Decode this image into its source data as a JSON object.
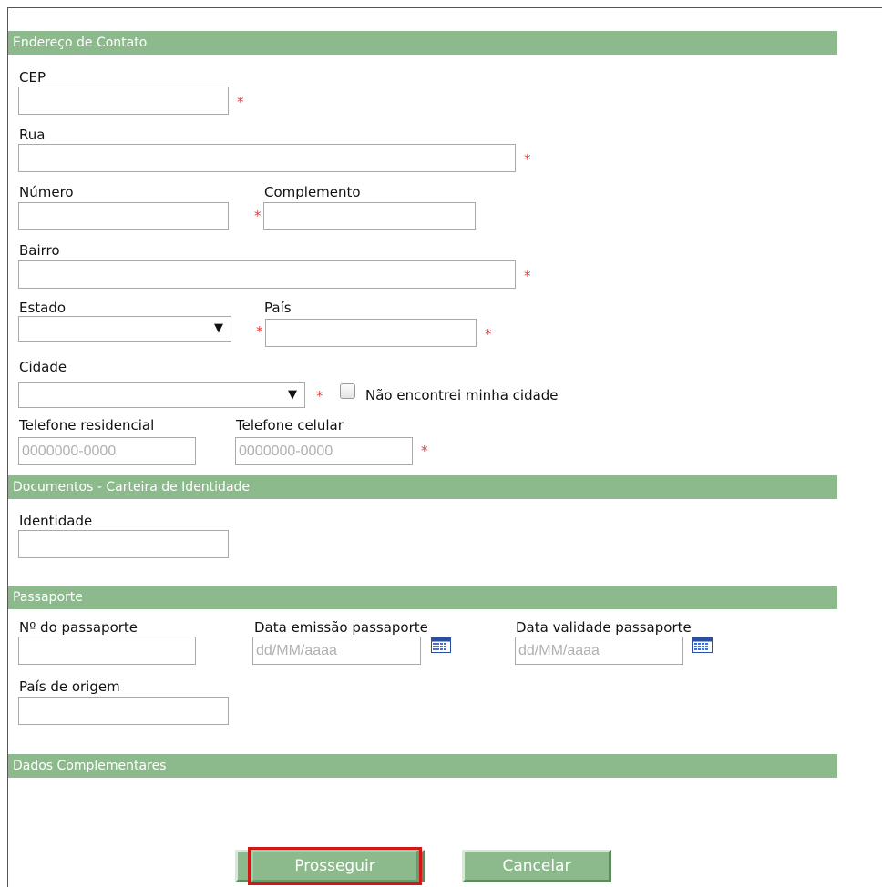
{
  "sections": {
    "contact_address": "Endereço de Contato",
    "documents": "Documentos - Carteira de Identidade",
    "passport": "Passaporte",
    "additional": "Dados Complementares"
  },
  "labels": {
    "cep": "CEP",
    "street": "Rua",
    "number": "Número",
    "complement": "Complemento",
    "neighborhood": "Bairro",
    "state": "Estado",
    "country": "País",
    "city": "Cidade",
    "city_not_found": "Não encontrei minha cidade",
    "home_phone": "Telefone residencial",
    "mobile_phone": "Telefone celular",
    "identity": "Identidade",
    "passport_number": "Nº do passaporte",
    "passport_issue_date": "Data emissão passaporte",
    "passport_expiry_date": "Data validade passaporte",
    "origin_country": "País de origem"
  },
  "required_marker": "*",
  "placeholders": {
    "phone": "0000000-0000",
    "date": "dd/MM/aaaa"
  },
  "values": {
    "cep": "",
    "street": "",
    "number": "",
    "complement": "",
    "neighborhood": "",
    "state": "",
    "country": "",
    "city": "",
    "home_phone": "",
    "mobile_phone": "",
    "identity": "",
    "passport_number": "",
    "issue_date": "",
    "expiry_date": "",
    "origin_country": ""
  },
  "buttons": {
    "proceed": "Prosseguir",
    "cancel": "Cancelar"
  },
  "icons": {
    "dropdown": "dropdown-arrow-icon",
    "calendar": "calendar-icon"
  },
  "colors": {
    "section_header": "#8cba8c",
    "required": "#e83a3a",
    "focus_outline": "#d01818"
  }
}
